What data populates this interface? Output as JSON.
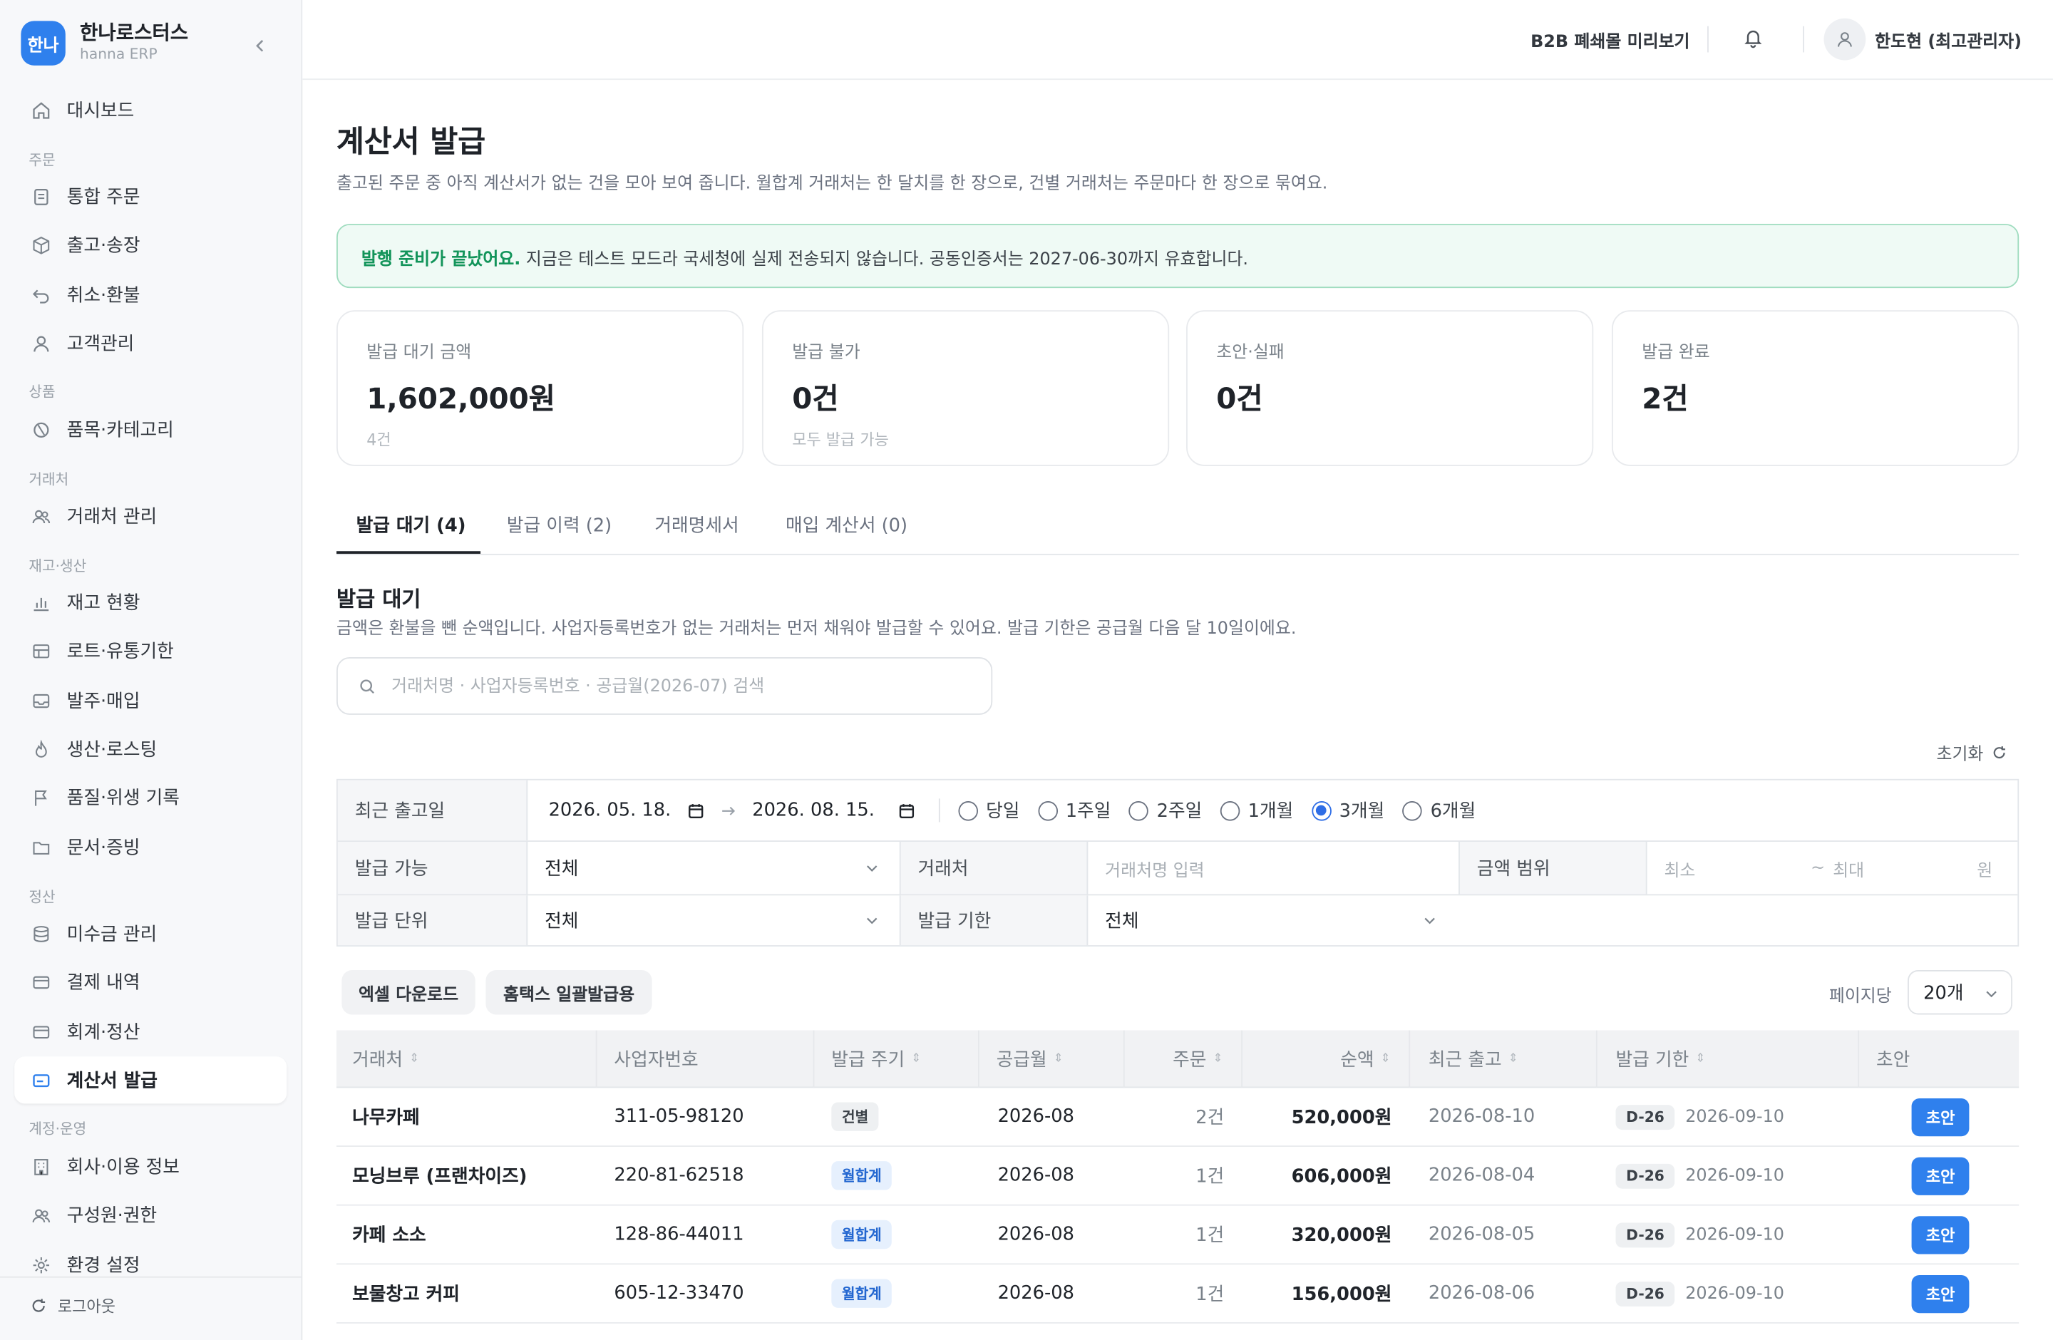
{
  "brand": {
    "logo": "한나",
    "name": "한나로스터스",
    "sub": "hanna ERP"
  },
  "sidebar": {
    "dashboard": "대시보드",
    "sections": {
      "order": "주문",
      "product": "상품",
      "partner": "거래처",
      "stock": "재고·생산",
      "settle": "정산",
      "account": "계정·운영"
    },
    "items": {
      "orders": "통합 주문",
      "shipping": "출고·송장",
      "refund": "취소·환불",
      "customers": "고객관리",
      "category": "품목·카테고리",
      "partners": "거래처 관리",
      "inventory": "재고 현황",
      "lot": "로트·유통기한",
      "purchase": "발주·매입",
      "roasting": "생산·로스팅",
      "quality": "품질·위생 기록",
      "docs": "문서·증빙",
      "receivable": "미수금 관리",
      "payments": "결제 내역",
      "accounting": "회계·정산",
      "invoice": "계산서 발급",
      "company": "회사·이용 정보",
      "members": "구성원·권한",
      "settings": "환경 설정"
    },
    "logout": "로그아웃"
  },
  "header": {
    "preview": "B2B 폐쇄몰 미리보기",
    "user": "한도현 (최고관리자)"
  },
  "page": {
    "title": "계산서 발급",
    "desc": "출고된 주문 중 아직 계산서가 없는 건을 모아 보여 줍니다. 월합계 거래처는 한 달치를 한 장으로, 건별 거래처는 주문마다 한 장으로 묶여요.",
    "notice_strong": "발행 준비가 끝났어요.",
    "notice_text": " 지금은 테스트 모드라 국세청에 실제 전송되지 않습니다. 공동인증서는 2027-06-30까지 유효합니다."
  },
  "stats": [
    {
      "label": "발급 대기 금액",
      "value": "1,602,000원",
      "sub": "4건"
    },
    {
      "label": "발급 불가",
      "value": "0건",
      "sub": "모두 발급 가능"
    },
    {
      "label": "초안·실패",
      "value": "0건",
      "sub": ""
    },
    {
      "label": "발급 완료",
      "value": "2건",
      "sub": ""
    }
  ],
  "tabs": [
    "발급 대기 (4)",
    "발급 이력 (2)",
    "거래명세서",
    "매입 계산서 (0)"
  ],
  "section": {
    "title": "발급 대기",
    "desc": "금액은 환불을 뺀 순액입니다. 사업자등록번호가 없는 거래처는 먼저 채워야 발급할 수 있어요. 발급 기한은 공급월 다음 달 10일이에요.",
    "search_placeholder": "거래처명 · 사업자등록번호 · 공급월(2026-07) 검색",
    "reset": "초기화"
  },
  "filters": {
    "recent_label": "최근 출고일",
    "date_from": "2026. 05. 18.",
    "date_to": "2026. 08. 15.",
    "ranges": [
      "당일",
      "1주일",
      "2주일",
      "1개월",
      "3개월",
      "6개월"
    ],
    "selected_range": "3개월",
    "issuable_label": "발급 가능",
    "issuable_value": "전체",
    "partner_label": "거래처",
    "partner_placeholder": "거래처명 입력",
    "amount_label": "금액 범위",
    "amount_min": "최소",
    "amount_tilde": "~",
    "amount_max": "최대",
    "amount_unit": "원",
    "unit_label": "발급 단위",
    "unit_value": "전체",
    "deadline_label": "발급 기한",
    "deadline_value": "전체"
  },
  "actions": {
    "excel": "엑셀 다운로드",
    "hometax": "홈택스 일괄발급용",
    "per_page_label": "페이지당",
    "per_page": "20개"
  },
  "table": {
    "columns": [
      "거래처",
      "사업자번호",
      "발급 주기",
      "공급월",
      "주문",
      "순액",
      "최근 출고",
      "발급 기한",
      "초안"
    ],
    "rows": [
      {
        "partner": "나무카페",
        "biz": "311-05-98120",
        "cycle": "건별",
        "month": "2026-08",
        "orders": "2건",
        "amount": "520,000원",
        "recent": "2026-08-10",
        "dday": "D-26",
        "deadline": "2026-09-10",
        "action": "초안"
      },
      {
        "partner": "모닝브루 (프랜차이즈)",
        "biz": "220-81-62518",
        "cycle": "월합계",
        "month": "2026-08",
        "orders": "1건",
        "amount": "606,000원",
        "recent": "2026-08-04",
        "dday": "D-26",
        "deadline": "2026-09-10",
        "action": "초안"
      },
      {
        "partner": "카페 소소",
        "biz": "128-86-44011",
        "cycle": "월합계",
        "month": "2026-08",
        "orders": "1건",
        "amount": "320,000원",
        "recent": "2026-08-05",
        "dday": "D-26",
        "deadline": "2026-09-10",
        "action": "초안"
      },
      {
        "partner": "보물창고 커피",
        "biz": "605-12-33470",
        "cycle": "월합계",
        "month": "2026-08",
        "orders": "1건",
        "amount": "156,000원",
        "recent": "2026-08-06",
        "dday": "D-26",
        "deadline": "2026-09-10",
        "action": "초안"
      }
    ]
  },
  "colors": {
    "accent": "#2f80ed",
    "success": "#12945a"
  }
}
